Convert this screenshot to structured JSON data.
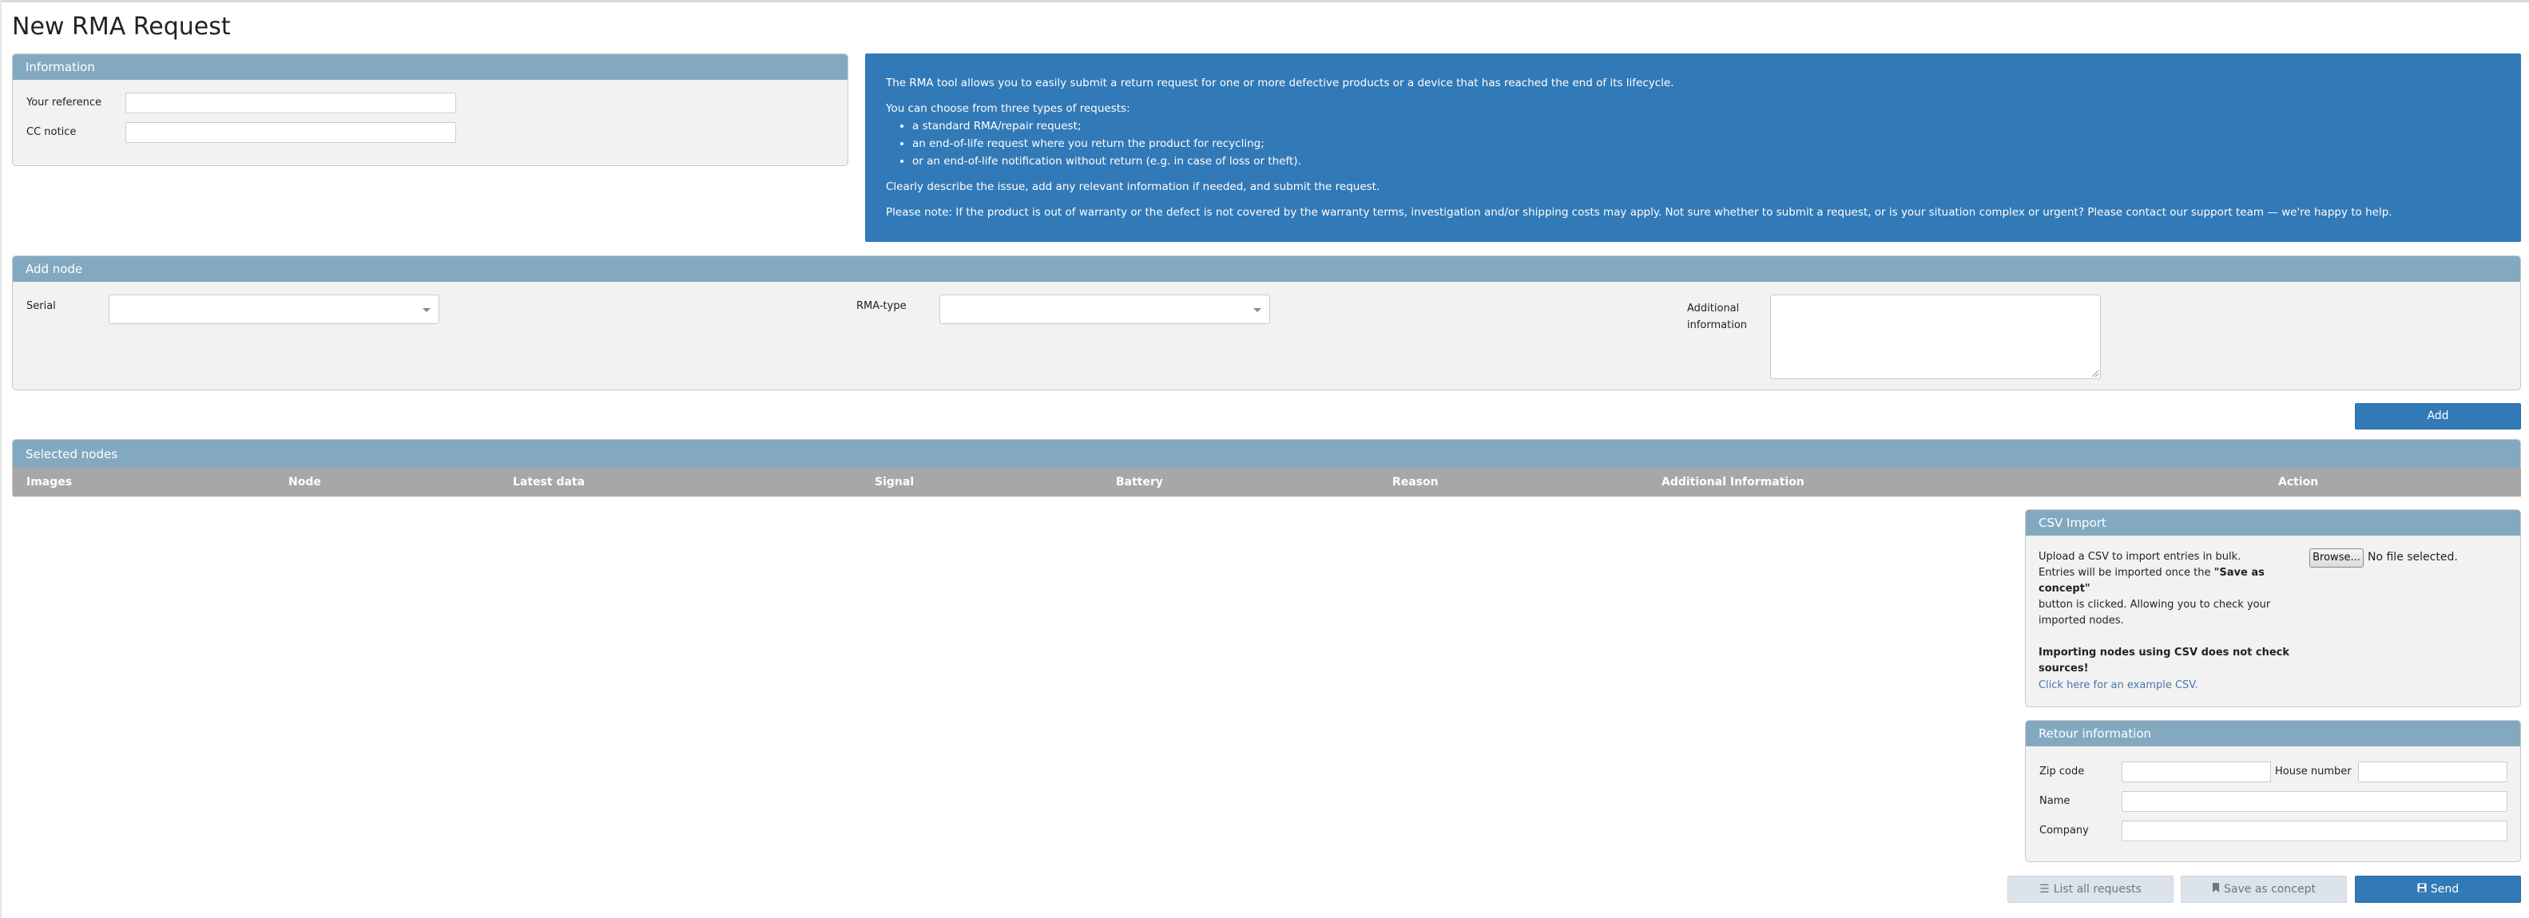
{
  "page": {
    "title": "New RMA Request"
  },
  "information_panel": {
    "title": "Information",
    "reference_label": "Your reference",
    "reference_value": "",
    "cc_label": "CC notice",
    "cc_value": ""
  },
  "info_box": {
    "intro": "The RMA tool allows you to easily submit a return request for one or more defective products or a device that has reached the end of its lifecycle.",
    "choose": "You can choose from three types of requests:",
    "types": [
      "a standard RMA/repair request;",
      "an end-of-life request where you return the product for recycling;",
      "or an end-of-life notification without return (e.g. in case of loss or theft)."
    ],
    "describe": "Clearly describe the issue, add any relevant information if needed, and submit the request.",
    "note": "Please note: If the product is out of warranty or the defect is not covered by the warranty terms, investigation and/or shipping costs may apply. Not sure whether to submit a request, or is your situation complex or urgent? Please contact our support team — we're happy to help."
  },
  "add_node": {
    "title": "Add node",
    "serial_label": "Serial",
    "serial_value": "",
    "rma_type_label": "RMA-type",
    "rma_type_value": "",
    "additional_label_line1": "Additional",
    "additional_label_line2": "information",
    "additional_value": "",
    "add_button": "Add"
  },
  "selected_nodes": {
    "title": "Selected nodes",
    "columns": [
      "Images",
      "Node",
      "Latest data",
      "Signal",
      "Battery",
      "Reason",
      "Additional Information",
      "Action"
    ]
  },
  "csv_import": {
    "title": "CSV Import",
    "line1": "Upload a CSV to import entries in bulk.",
    "line2_pre": "Entries will be imported once the ",
    "line2_bold": "\"Save as concept\"",
    "line3": "button is clicked. Allowing you to check your",
    "line4": "imported nodes.",
    "warning_line1": "Importing nodes using CSV does not check",
    "warning_line2": "sources!",
    "example_link": "Click here for an example CSV.",
    "browse_label": "Browse...",
    "no_file": "No file selected."
  },
  "retour_information": {
    "title": "Retour information",
    "zip_label": "Zip code",
    "zip_value": "",
    "house_number_label": "House number",
    "house_number_value": "",
    "name_label": "Name",
    "name_value": "",
    "company_label": "Company",
    "company_value": ""
  },
  "footer_buttons": {
    "list_label": "List all requests",
    "list_icon": "list-icon",
    "concept_label": "Save as concept",
    "concept_icon": "bookmark-icon",
    "send_label": "Send",
    "send_icon": "save-icon"
  },
  "colors": {
    "panel_header": "#83a9c1",
    "info_box": "#3279b7",
    "primary_button": "#3279b7",
    "table_header": "#a7a7a7"
  }
}
